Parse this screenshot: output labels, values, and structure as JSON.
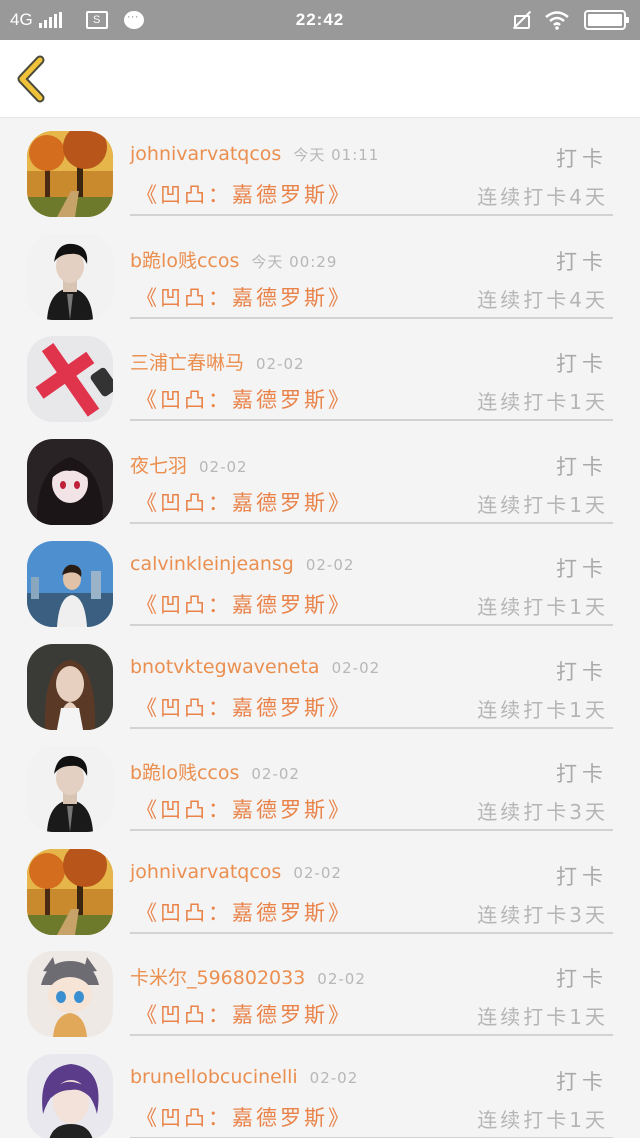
{
  "status_bar": {
    "network": "4G",
    "time": "22:42",
    "sim_icon_label": "S"
  },
  "nav": {
    "back_icon": "chevron-left-icon",
    "accent_color": "#f0c23a"
  },
  "colors": {
    "name": "#eb8f50",
    "book": "#e9834a",
    "muted": "#b5b5b5"
  },
  "records": [
    {
      "name": "johnivarvatqcos",
      "time": "今天 01:11",
      "action": "打卡",
      "book": "《凹凸：嘉德罗斯》",
      "streak": "连续打卡4天",
      "avatar": "autumn-trees-avatar"
    },
    {
      "name": "b跪lo贱ccos",
      "time": "今天 00:29",
      "action": "打卡",
      "book": "《凹凸：嘉德罗斯》",
      "streak": "连续打卡4天",
      "avatar": "man-portrait-avatar"
    },
    {
      "name": "三浦亡春啉马",
      "time": "02-02",
      "action": "打卡",
      "book": "《凹凸：嘉德罗斯》",
      "streak": "连续打卡1天",
      "avatar": "red-cross-avatar"
    },
    {
      "name": "夜七羽",
      "time": "02-02",
      "action": "打卡",
      "book": "《凹凸：嘉德罗斯》",
      "streak": "连续打卡1天",
      "avatar": "anime-girl-avatar"
    },
    {
      "name": "calvinkleinjeansg",
      "time": "02-02",
      "action": "打卡",
      "book": "《凹凸：嘉德罗斯》",
      "streak": "连续打卡1天",
      "avatar": "harbor-man-avatar"
    },
    {
      "name": "bnotvktegwaveneta",
      "time": "02-02",
      "action": "打卡",
      "book": "《凹凸：嘉德罗斯》",
      "streak": "连续打卡1天",
      "avatar": "woman-portrait-avatar"
    },
    {
      "name": "b跪lo贱ccos",
      "time": "02-02",
      "action": "打卡",
      "book": "《凹凸：嘉德罗斯》",
      "streak": "连续打卡3天",
      "avatar": "man-portrait-avatar"
    },
    {
      "name": "johnivarvatqcos",
      "time": "02-02",
      "action": "打卡",
      "book": "《凹凸：嘉德罗斯》",
      "streak": "连续打卡3天",
      "avatar": "autumn-trees-avatar"
    },
    {
      "name": "卡米尔_596802033",
      "time": "02-02",
      "action": "打卡",
      "book": "《凹凸：嘉德罗斯》",
      "streak": "连续打卡1天",
      "avatar": "chibi-character-avatar"
    },
    {
      "name": "brunellobcucinelli",
      "time": "02-02",
      "action": "打卡",
      "book": "《凹凸：嘉德罗斯》",
      "streak": "连续打卡1天",
      "avatar": "purple-hair-avatar"
    }
  ]
}
